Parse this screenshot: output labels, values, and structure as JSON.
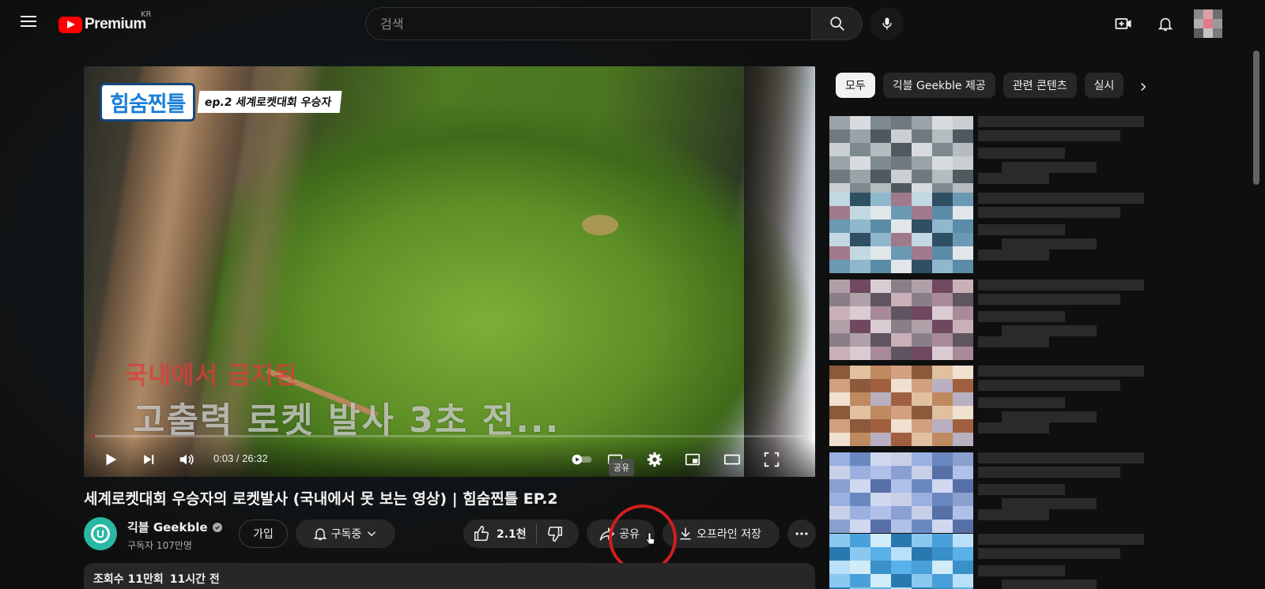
{
  "header": {
    "logo_text": "Premium",
    "region": "KR",
    "search": {
      "placeholder": "검색",
      "value": ""
    },
    "icons": [
      "menu-icon",
      "search-icon",
      "mic-icon",
      "create-icon",
      "bell-icon"
    ]
  },
  "player": {
    "show_name": "힘숨찐틀",
    "show_episode": "ep.2 세계로켓대회 우승자",
    "caption_red": "국내에서 금지된",
    "caption_white": "고출력 로켓 발사 3초 전...",
    "time_current": "0:03",
    "time_separator": " / ",
    "time_total": "26:32",
    "progress": 0.002,
    "tooltip": "공유"
  },
  "video": {
    "title": "세계로켓대회 우승자의 로켓발사 (국내에서 못 보는 영상) | 힘숨찐틀 EP.2",
    "channel_name": "긱블 Geekble",
    "subscribers": "구독자 107만명",
    "join_label": "가입",
    "subscribe_label": "구독중",
    "like_count": "2.1천",
    "share_label": "공유",
    "offline_label": "오프라인 저장",
    "views": "조회수 11만회",
    "uploaded": "11시간 전"
  },
  "sidebar": {
    "chips": [
      {
        "label": "모두",
        "active": true
      },
      {
        "label": "긱블 Geekble 제공",
        "active": false
      },
      {
        "label": "관련 콘텐츠",
        "active": false
      },
      {
        "label": "실시",
        "active": false
      }
    ]
  },
  "colors": {
    "background": "#0f0f0f",
    "accent_red": "#ff0000",
    "annotation_circle": "#d21e1e",
    "pill": "#272727"
  }
}
